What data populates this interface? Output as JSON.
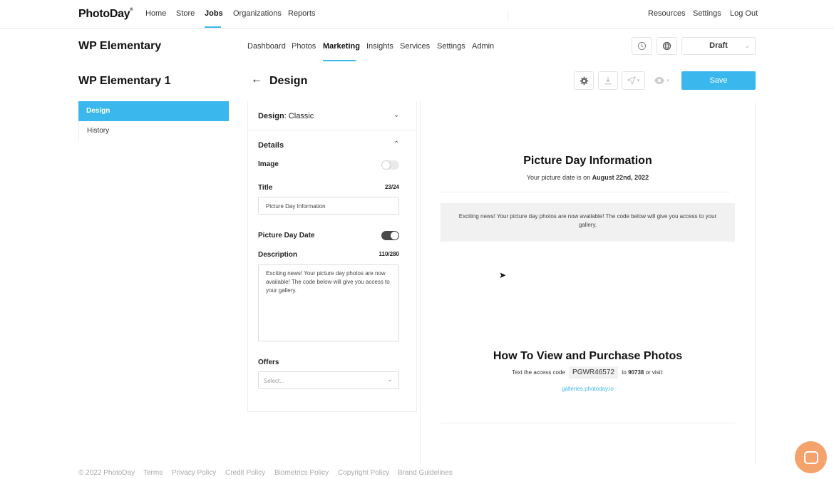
{
  "nav": {
    "logo": "PhotoDay",
    "links": [
      "Home",
      "Store",
      "Jobs",
      "Organizations",
      "Reports"
    ],
    "right_links": [
      "Resources",
      "Settings",
      "Log Out"
    ]
  },
  "job": {
    "title": "WP Elementary",
    "tabs": [
      "Dashboard",
      "Photos",
      "Marketing",
      "Insights",
      "Services",
      "Settings",
      "Admin"
    ],
    "status": "Draft"
  },
  "sidebar": {
    "campaign_title": "WP Elementary 1",
    "items": [
      "Design",
      "History"
    ]
  },
  "design": {
    "back_icon": "arrow-left-icon",
    "title": "Design",
    "save_label": "Save"
  },
  "editor": {
    "design_label": "Design",
    "design_value": ": Classic",
    "details_label": "Details",
    "image_label": "Image",
    "image_toggle_on": false,
    "title_label": "Title",
    "title_count": "23/24",
    "title_value": "Picture Day Information",
    "picture_day_label": "Picture Day Date",
    "picture_day_toggle_on": true,
    "description_label": "Description",
    "description_count": "110/280",
    "description_value": "Exciting news! Your picture day photos are now available! The code below will give you access to your gallery.",
    "offers_label": "Offers",
    "offers_placeholder": "Select..."
  },
  "preview": {
    "heading": "Picture Day Information",
    "date_prefix": "Your picture date is on ",
    "date_value": "August 22nd, 2022",
    "message": "Exciting news! Your picture day photos are now available! The code below will give you access to your gallery.",
    "how_heading": "How To View and Purchase Photos",
    "text_prefix": "Text the access code",
    "access_code": "PGWR46572",
    "to_word": "to",
    "number": "90738",
    "or_visit": "or visit:",
    "link": "galleries.photoday.io"
  },
  "footer": {
    "copyright": "© 2022 PhotoDay",
    "links": [
      "Terms",
      "Privacy Policy",
      "Credit Policy",
      "Biometrics Policy",
      "Copyright Policy",
      "Brand Guidelines"
    ]
  },
  "colors": {
    "accent": "#3ab8ee",
    "chat": "#f5a36c"
  }
}
